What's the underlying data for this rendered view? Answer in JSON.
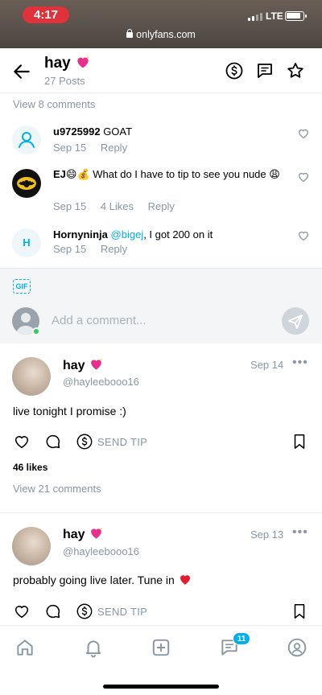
{
  "status_bar": {
    "time": "4:17",
    "network": "LTE"
  },
  "browser": {
    "url": "onlyfans.com"
  },
  "header": {
    "name": "hay",
    "posts_count": "27 Posts"
  },
  "comments_section": {
    "view_more": "View 8 comments",
    "comments": [
      {
        "user": "u9725992",
        "text": "GOAT",
        "date": "Sep 15",
        "likes": "",
        "reply": "Reply",
        "avatar": "person-icon"
      },
      {
        "user": "EJ😄💰",
        "text": "What do I have to tip to see you nude 😩",
        "date": "Sep 15",
        "likes": "4 Likes",
        "reply": "Reply",
        "avatar": "batman-avatar"
      },
      {
        "user": "Hornyninja",
        "mention": "@bigej",
        "text": ", I got 200 on it",
        "date": "Sep 15",
        "likes": "",
        "reply": "Reply",
        "avatar_letter": "H"
      }
    ],
    "composer": {
      "gif_label": "GIF",
      "placeholder": "Add a comment..."
    }
  },
  "posts": [
    {
      "name": "hay",
      "handle": "@hayleebooo16",
      "date": "Sep 14",
      "text": "live tonight I promise :)",
      "send_tip": "SEND TIP",
      "likes": "46 likes",
      "view_comments": "View 21 comments"
    },
    {
      "name": "hay",
      "handle": "@hayleebooo16",
      "date": "Sep 13",
      "text": "probably going live later. Tune in",
      "send_tip": "SEND TIP"
    }
  ],
  "bottom_nav": {
    "messages_badge": "11"
  },
  "colors": {
    "accent": "#00aff0",
    "muted": "#8a96a3",
    "heart_emoji": "#e8308a",
    "time_pill": "#e0323b"
  }
}
